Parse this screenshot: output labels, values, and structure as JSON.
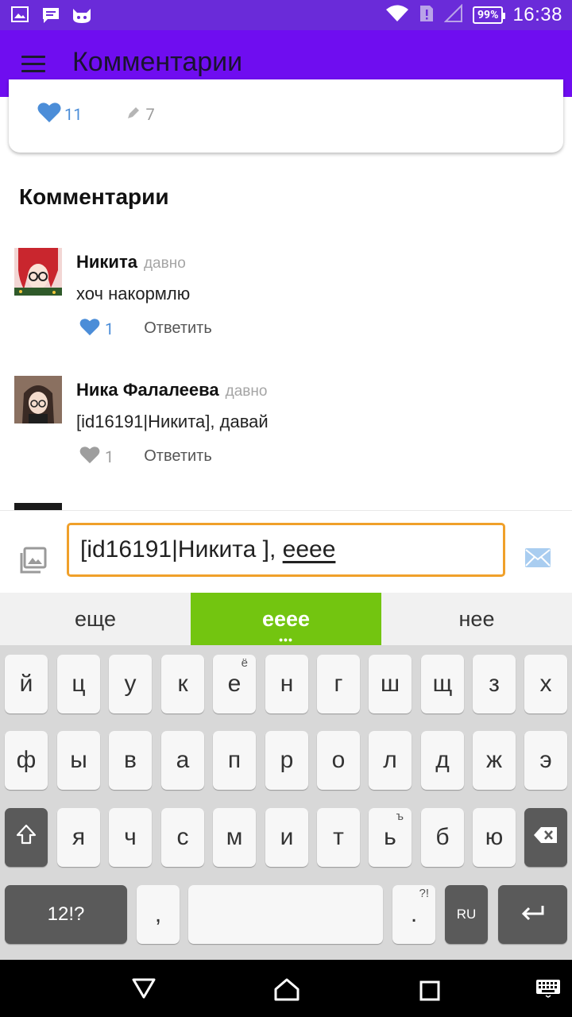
{
  "status_bar": {
    "battery": "99%",
    "time": "16:38",
    "icons": [
      "gallery-icon",
      "message-icon",
      "cat-app-icon",
      "wifi-icon",
      "sim-alert-icon",
      "signal-icon",
      "battery-icon"
    ]
  },
  "app_bar": {
    "title": "Комментарии"
  },
  "post": {
    "likes": "11",
    "comments": "7"
  },
  "comments_section": {
    "title": "Комментарии",
    "items": [
      {
        "name": "Никита",
        "time": "давно",
        "text": "хоч накормлю",
        "likes": "1",
        "liked": true,
        "reply_label": "Ответить"
      },
      {
        "name": "Ника Фалалеева",
        "time": "давно",
        "text": "[id16191|Никита], давай",
        "likes": "1",
        "liked": false,
        "reply_label": "Ответить"
      }
    ]
  },
  "input": {
    "value_prefix": "[id16191|Никита ], ",
    "value_composing": "eeee"
  },
  "suggestions": [
    "еще",
    "eeee",
    "нее"
  ],
  "keyboard": {
    "row1": [
      "й",
      "ц",
      "у",
      "к",
      "е",
      "н",
      "г",
      "ш",
      "щ",
      "з",
      "х"
    ],
    "row2": [
      "ф",
      "ы",
      "в",
      "а",
      "п",
      "р",
      "о",
      "л",
      "д",
      "ж",
      "э"
    ],
    "row3": [
      "я",
      "ч",
      "с",
      "м",
      "и",
      "т",
      "ь",
      "б",
      "ю"
    ],
    "alt_e": "ё",
    "alt_soft": "ъ",
    "symbols_label": "12!?",
    "comma": ",",
    "period": ".",
    "period_alt": "?!",
    "lang_label": "RU"
  },
  "colors": {
    "status_bar": "#6a2bd9",
    "app_bar": "#6f0df0",
    "like_blue": "#4b8dd8",
    "input_border": "#f0a02a",
    "suggestion_active": "#73c510"
  }
}
